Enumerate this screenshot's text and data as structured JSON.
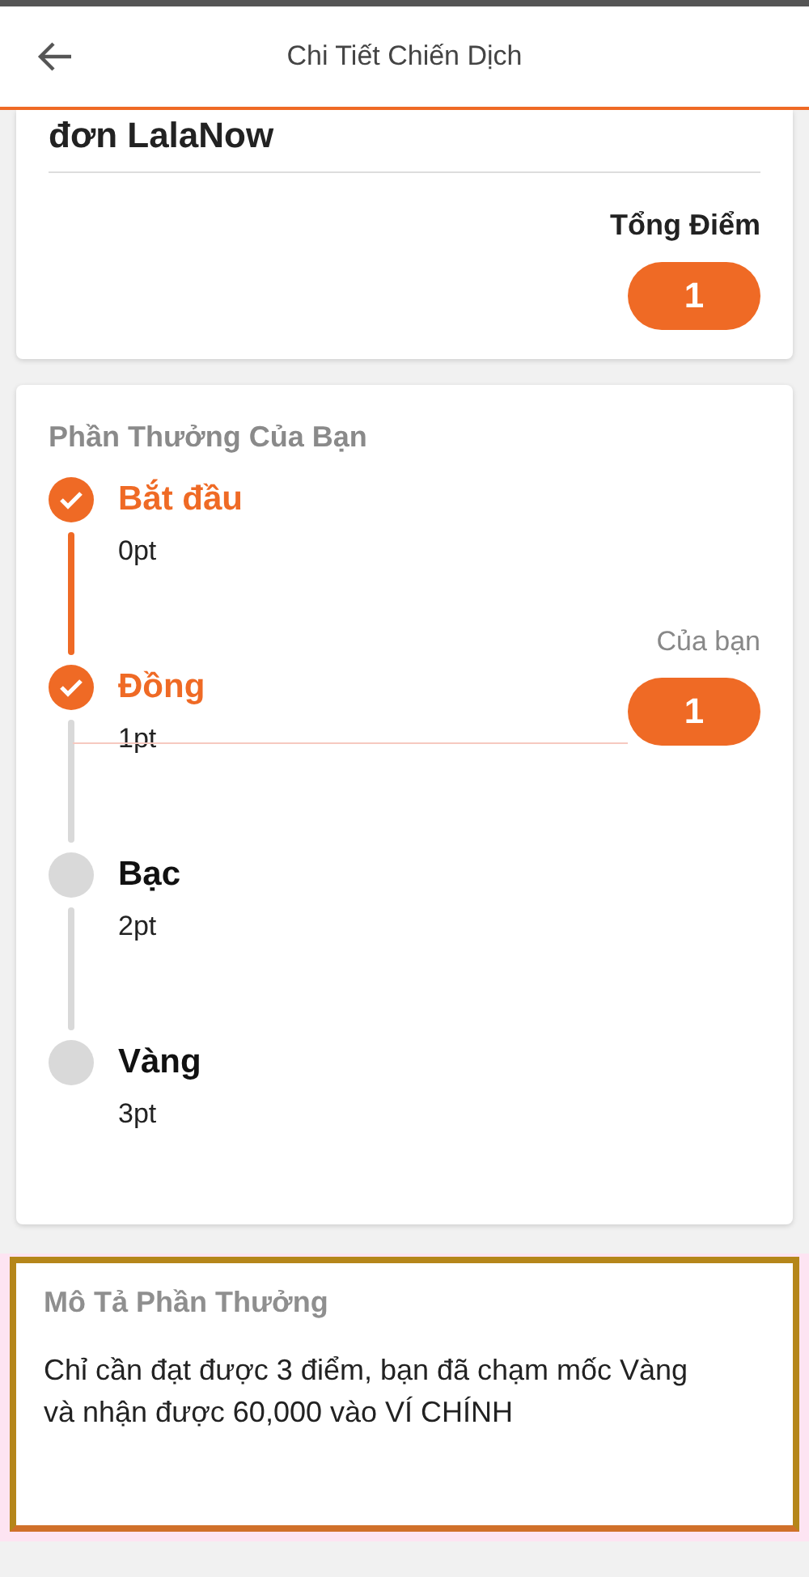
{
  "header": {
    "title": "Chi Tiết Chiến Dịch"
  },
  "campaign": {
    "title": "đơn LalaNow",
    "total_label": "Tổng Điểm",
    "total_value": "1"
  },
  "rewards": {
    "title": "Phần Thưởng Của Bạn",
    "milestones": [
      {
        "name": "Bắt đầu",
        "points": "0pt",
        "reached": true
      },
      {
        "name": "Đồng",
        "points": "1pt",
        "reached": true,
        "marker": {
          "label": "Của bạn",
          "value": "1"
        }
      },
      {
        "name": "Bạc",
        "points": "2pt",
        "reached": false
      },
      {
        "name": "Vàng",
        "points": "3pt",
        "reached": false
      }
    ]
  },
  "description": {
    "title": "Mô Tả Phần Thưởng",
    "text": "Chỉ cần đạt được 3 điểm, bạn đã chạm mốc Vàng và nhận được 60,000 vào VÍ CHÍNH"
  }
}
